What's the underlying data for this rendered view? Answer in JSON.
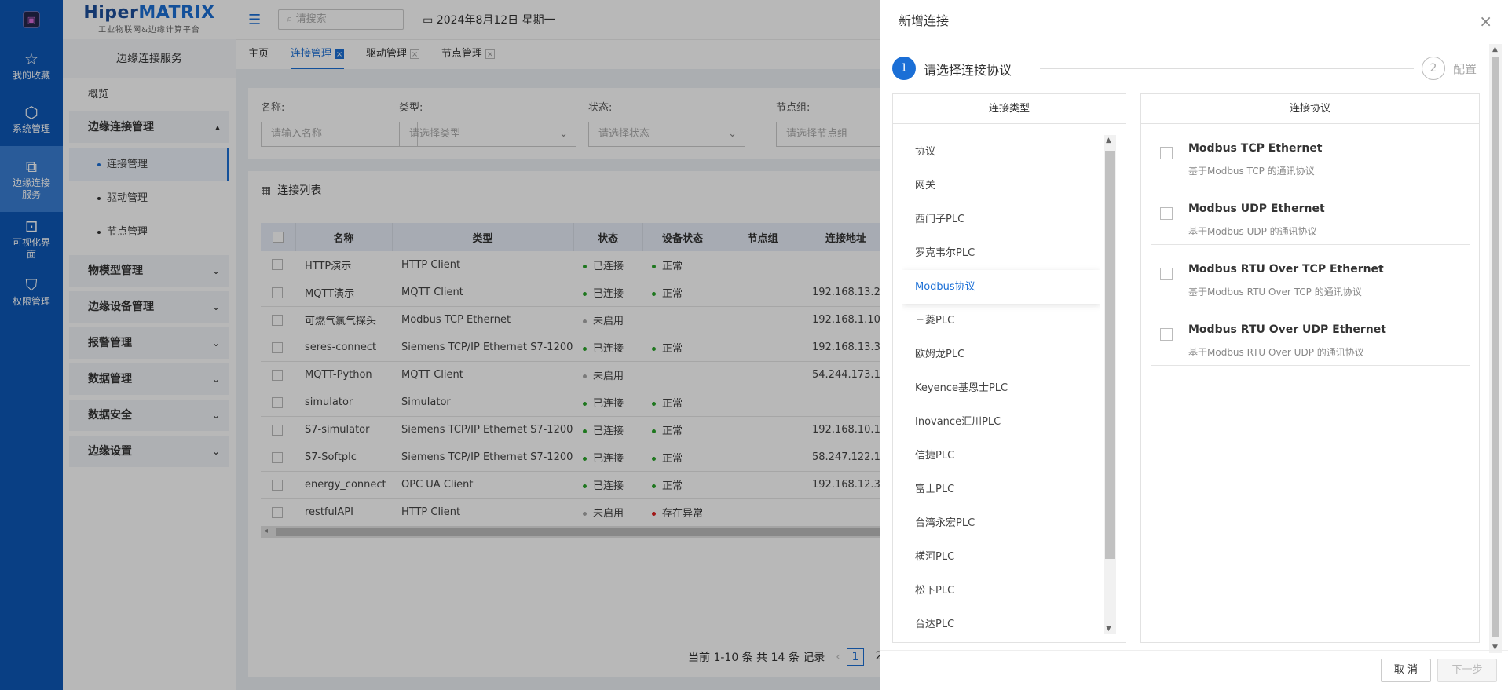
{
  "rail": {
    "items": [
      {
        "label": "我的收藏",
        "icon": "star-icon"
      },
      {
        "label": "系统管理",
        "icon": "cube-icon"
      },
      {
        "label": "边缘连接服务",
        "icon": "link-icon"
      },
      {
        "label": "可视化界面",
        "icon": "dashboard-icon"
      },
      {
        "label": "权限管理",
        "icon": "shield-icon"
      }
    ]
  },
  "brand": {
    "name_part1": "Hiper",
    "name_part2": "MATRIX",
    "subtitle": "工业物联网&边缘计算平台"
  },
  "sidebar": {
    "title": "边缘连接服务",
    "overview": "概览",
    "groups": [
      {
        "label": "边缘连接管理",
        "chevron": "▴"
      },
      {
        "label": "物模型管理",
        "chevron": "⌄"
      },
      {
        "label": "边缘设备管理",
        "chevron": "⌄"
      },
      {
        "label": "报警管理",
        "chevron": "⌄"
      },
      {
        "label": "数据管理",
        "chevron": "⌄"
      },
      {
        "label": "数据安全",
        "chevron": "⌄"
      },
      {
        "label": "边缘设置",
        "chevron": "⌄"
      }
    ],
    "subitems": [
      {
        "label": "连接管理"
      },
      {
        "label": "驱动管理"
      },
      {
        "label": "节点管理"
      }
    ]
  },
  "topbar": {
    "search_placeholder": "请搜索",
    "date": "2024年8月12日 星期一"
  },
  "tabs": [
    {
      "label": "主页"
    },
    {
      "label": "连接管理"
    },
    {
      "label": "驱动管理"
    },
    {
      "label": "节点管理"
    }
  ],
  "filters": [
    {
      "label": "名称:",
      "placeholder": "请输入名称"
    },
    {
      "label": "类型:",
      "placeholder": "请选择类型"
    },
    {
      "label": "状态:",
      "placeholder": "请选择状态"
    },
    {
      "label": "节点组:",
      "placeholder": "请选择节点组"
    }
  ],
  "list": {
    "title": "连接列表",
    "columns": [
      "名称",
      "类型",
      "状态",
      "设备状态",
      "节点组",
      "连接地址"
    ],
    "rows": [
      {
        "name": "HTTP演示",
        "type": "HTTP Client",
        "status": "已连接",
        "status_color": "#2aa52a",
        "device": "正常",
        "device_color": "#2aa52a",
        "group": "",
        "addr": ""
      },
      {
        "name": "MQTT演示",
        "type": "MQTT Client",
        "status": "已连接",
        "status_color": "#2aa52a",
        "device": "正常",
        "device_color": "#2aa52a",
        "group": "",
        "addr": "192.168.13.2"
      },
      {
        "name": "可燃气氯气探头",
        "type": "Modbus TCP Ethernet",
        "status": "未启用",
        "status_color": "#aaaaaa",
        "device": "",
        "device_color": "",
        "group": "",
        "addr": "192.168.1.10"
      },
      {
        "name": "seres-connect",
        "type": "Siemens TCP/IP Ethernet S7-1200",
        "status": "已连接",
        "status_color": "#2aa52a",
        "device": "正常",
        "device_color": "#2aa52a",
        "group": "",
        "addr": "192.168.13.3"
      },
      {
        "name": "MQTT-Python",
        "type": "MQTT Client",
        "status": "未启用",
        "status_color": "#aaaaaa",
        "device": "",
        "device_color": "",
        "group": "",
        "addr": "54.244.173.1"
      },
      {
        "name": "simulator",
        "type": "Simulator",
        "status": "已连接",
        "status_color": "#2aa52a",
        "device": "正常",
        "device_color": "#2aa52a",
        "group": "",
        "addr": ""
      },
      {
        "name": "S7-simulator",
        "type": "Siemens TCP/IP Ethernet S7-1200",
        "status": "已连接",
        "status_color": "#2aa52a",
        "device": "正常",
        "device_color": "#2aa52a",
        "group": "",
        "addr": "192.168.10.1"
      },
      {
        "name": "S7-Softplc",
        "type": "Siemens TCP/IP Ethernet S7-1200",
        "status": "已连接",
        "status_color": "#2aa52a",
        "device": "正常",
        "device_color": "#2aa52a",
        "group": "",
        "addr": "58.247.122.1"
      },
      {
        "name": "energy_connect",
        "type": "OPC UA Client",
        "status": "已连接",
        "status_color": "#2aa52a",
        "device": "正常",
        "device_color": "#2aa52a",
        "group": "",
        "addr": "192.168.12.3"
      },
      {
        "name": "restfulAPI",
        "type": "HTTP Client",
        "status": "未启用",
        "status_color": "#aaaaaa",
        "device": "存在异常",
        "device_color": "#e02020",
        "group": "",
        "addr": ""
      }
    ]
  },
  "pager": {
    "summary": "当前 1-10 条 共 14 条 记录",
    "prev": "‹",
    "pages": [
      "1",
      "2"
    ]
  },
  "drawer": {
    "title": "新增连接",
    "close": "×",
    "steps": [
      {
        "num": "1",
        "label": "请选择连接协议"
      },
      {
        "num": "2",
        "label": "配置"
      }
    ],
    "type_panel_title": "连接类型",
    "protocol_panel_title": "连接协议",
    "types": [
      "协议",
      "网关",
      "西门子PLC",
      "罗克韦尔PLC",
      "Modbus协议",
      "三菱PLC",
      "欧姆龙PLC",
      "Keyence基恩士PLC",
      "Inovance汇川PLC",
      "信捷PLC",
      "富士PLC",
      "台湾永宏PLC",
      "横河PLC",
      "松下PLC",
      "台达PLC"
    ],
    "selected_type": "Modbus协议",
    "protocols": [
      {
        "name": "Modbus TCP Ethernet",
        "desc": "基于Modbus TCP 的通讯协议"
      },
      {
        "name": "Modbus UDP Ethernet",
        "desc": "基于Modbus UDP 的通讯协议"
      },
      {
        "name": "Modbus RTU Over TCP Ethernet",
        "desc": "基于Modbus RTU Over TCP 的通讯协议"
      },
      {
        "name": "Modbus RTU Over UDP Ethernet",
        "desc": "基于Modbus RTU Over UDP 的通讯协议"
      }
    ],
    "cancel_label": "取 消",
    "next_label": "下一步"
  },
  "colors": {
    "primary": "#1b6fd6",
    "rail": "#0d58b8",
    "ok": "#2aa52a",
    "error": "#e02020"
  }
}
